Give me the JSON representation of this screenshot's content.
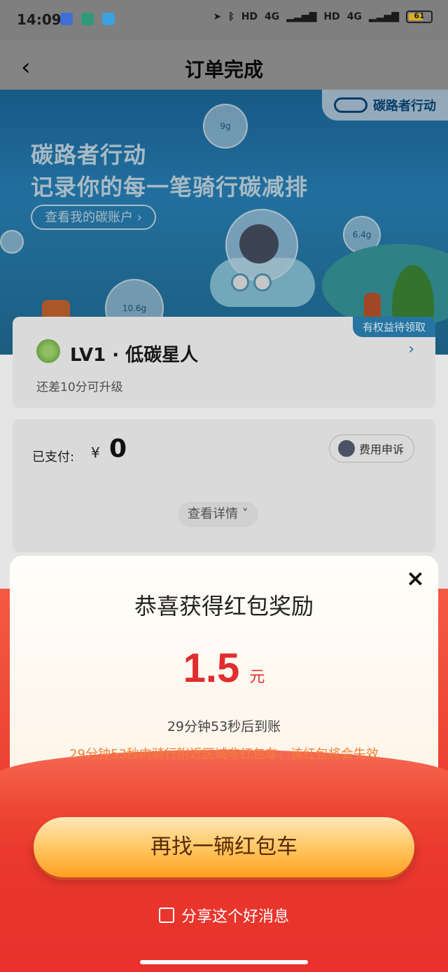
{
  "status_bar": {
    "time": "14:09",
    "battery": "61",
    "net1": "4G",
    "net2": "4G",
    "hd": "HD"
  },
  "header": {
    "back_icon": "chevron-left-icon",
    "title": "订单完成"
  },
  "banner": {
    "brand": "碳路者行动",
    "headline1": "碳路者行动",
    "headline2": "记录你的每一笔骑行碳减排",
    "account_button": "查看我的碳账户 ›",
    "bubbles": [
      "9g",
      "6.4g",
      "10.6g"
    ]
  },
  "level_card": {
    "tag": "有权益待领取",
    "title": "LV1 · 低碳星人",
    "subtitle": "还差10分可升级",
    "arrow": "›"
  },
  "payment": {
    "paid_label": "已支付:",
    "currency": "¥",
    "amount": "0",
    "appeal_button": "费用申诉",
    "details_button": "查看详情 ˅"
  },
  "modal": {
    "close_icon": "×",
    "title": "恭喜获得红包奖励",
    "amount": "1.5",
    "unit": "元",
    "arrival_note": "29分钟53秒后到账",
    "warning": "29分钟53秒内骑行附近区域非红包车，该红包将会失效",
    "cta": "再找一辆红包车",
    "share": "分享这个好消息"
  },
  "colors": {
    "accent_red": "#e12d2d",
    "warning_orange": "#f08038",
    "cta_orange": "#ffb43a"
  }
}
